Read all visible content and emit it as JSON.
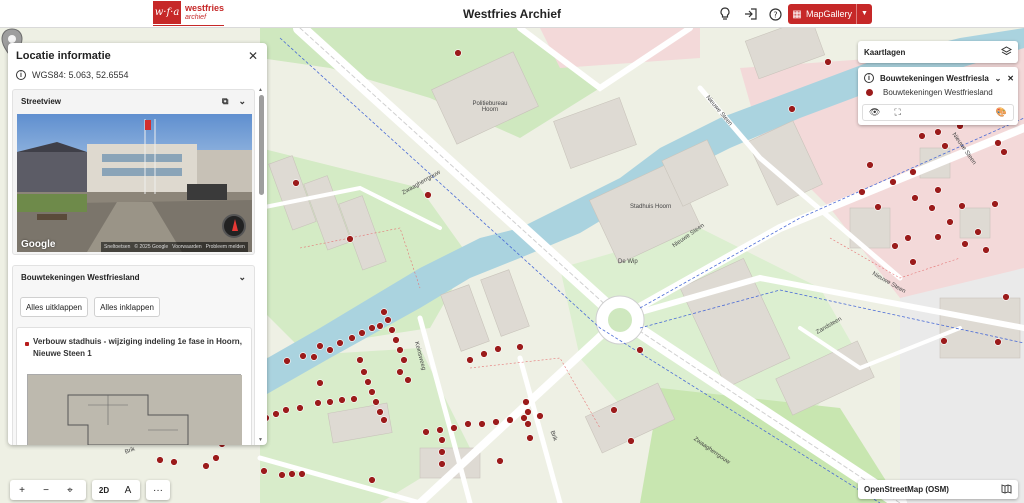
{
  "header": {
    "logo_mark": "w·f·a",
    "logo_line1": "westfries",
    "logo_line2": "archief",
    "title": "Westfries Archief",
    "icons": [
      "lightbulb-icon",
      "login-icon",
      "help-icon"
    ],
    "mapgallery_label": "MapGallery"
  },
  "panel": {
    "title": "Locatie informatie",
    "coordinates": "WGS84: 5.063, 52.6554",
    "streetview": {
      "title": "Streetview",
      "google_label": "Google",
      "footer_items": [
        "Sneltoetsen",
        "© 2025 Google",
        "Voorwaarden",
        "Probleem melden"
      ]
    },
    "bouwtekeningen": {
      "title": "Bouwtekeningen Westfriesland",
      "expand_all": "Alles uitklappen",
      "collapse_all": "Alles inklappen",
      "item_title": "Verbouw stadhuis - wijziging indeling 1e fase in Hoorn, Nieuwe Steen 1"
    }
  },
  "layers": {
    "title": "Kaartlagen",
    "layer_name": "Bouwtekeningen Westfriesland",
    "legend_label": "Bouwtekeningen Westfriesland",
    "legend_color": "#9b1b1b"
  },
  "controls": {
    "zoom_in": "+",
    "zoom_out": "−",
    "locate": "⌖",
    "mode_2d": "2D",
    "north": "A",
    "more": "···"
  },
  "basemap": {
    "label": "OpenStreetMap (OSM)"
  },
  "map_labels": {
    "politiebureau": "Politiebureau Hoorn",
    "stadhuis": "Stadhuis Hoorn",
    "dewip": "De Wip",
    "zwaaghe1": "Zwaagherrgouw",
    "zwaaghe2": "Zwaagherrgouw",
    "nieuwe_steen1": "Nieuwe Steen",
    "nieuwe_steen2": "Nieuwe Steen",
    "nieuwe_steen3": "Nieuwe Steen",
    "nieuwe_steen4": "Nieuwe Steen",
    "zandsteen": "Zandsteen",
    "kerkweg": "Keinsweeg",
    "brik": "Brik",
    "brik2": "Brik"
  },
  "colors": {
    "accent": "#c62828",
    "marker": "#9b1b1b",
    "water": "#aad3df",
    "park": "#c8e6b0",
    "residential": "#f2dada"
  }
}
